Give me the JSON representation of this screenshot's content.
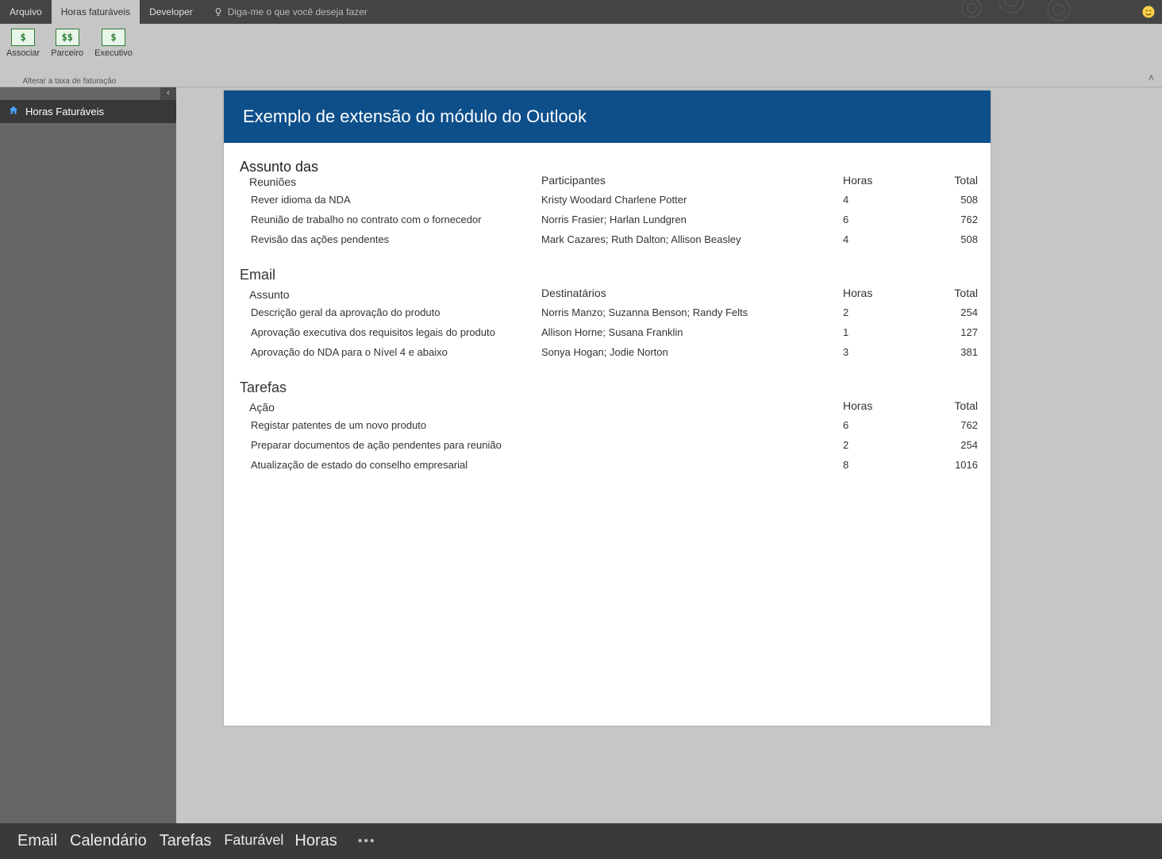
{
  "titlebar": {
    "tabs": [
      {
        "label": "Arquivo"
      },
      {
        "label": "Horas faturáveis"
      },
      {
        "label": "Developer"
      }
    ],
    "tell_me": "Diga-me o que você deseja fazer"
  },
  "ribbon": {
    "buttons": [
      {
        "glyph": "$",
        "label": "Associar"
      },
      {
        "glyph": "$$",
        "label": "Parceiro"
      },
      {
        "glyph": "$",
        "label": "Executivo"
      }
    ],
    "group_label": "Alterar a taxa de faturação"
  },
  "sidebar": {
    "items": [
      {
        "label": "Horas Faturáveis"
      }
    ]
  },
  "page": {
    "title": "Exemplo de extensão do módulo do Outlook",
    "group1_super": "Assunto das",
    "sections": [
      {
        "title": "Reuniões",
        "col2_header": "Participantes",
        "hours_header": "Horas",
        "total_header": "Total",
        "rows": [
          {
            "c1": "Rever idioma da NDA",
            "c2": "Kristy Woodard Charlene Potter",
            "hours": "4",
            "total": "508"
          },
          {
            "c1": "Reunião de trabalho no contrato com o fornecedor",
            "c2": "Norris Frasier; Harlan Lundgren",
            "hours": "6",
            "total": "762"
          },
          {
            "c1": "Revisão das ações pendentes",
            "c2": "Mark Cazares; Ruth Dalton; Allison Beasley",
            "hours": "4",
            "total": "508"
          }
        ]
      },
      {
        "title": "Email",
        "col1_header": "Assunto",
        "col2_header": "Destinatários",
        "hours_header": "Horas",
        "total_header": "Total",
        "rows": [
          {
            "c1": "Descrição geral da aprovação do produto",
            "c2": "Norris Manzo; Suzanna Benson; Randy Felts",
            "hours": "2",
            "total": "254"
          },
          {
            "c1": "Aprovação executiva dos requisitos legais do produto",
            "c2": "Allison Horne; Susana Franklin",
            "hours": "1",
            "total": "127"
          },
          {
            "c1": "Aprovação do NDA para o Nível 4 e abaixo",
            "c2": "Sonya Hogan; Jodie Norton",
            "hours": "3",
            "total": "381"
          }
        ]
      },
      {
        "title": "Tarefas",
        "col1_header": "Ação",
        "hours_header": "Horas",
        "total_header": "Total",
        "rows": [
          {
            "c1": "Registar patentes de um novo produto",
            "c2": "",
            "hours": "6",
            "total": "762"
          },
          {
            "c1": "Preparar documentos de ação pendentes para reunião",
            "c2": "",
            "hours": "2",
            "total": "254"
          },
          {
            "c1": "Atualização de estado do conselho empresarial",
            "c2": "",
            "hours": "8",
            "total": "1016"
          }
        ]
      }
    ]
  },
  "bottombar": {
    "items": [
      "Email",
      "Calendário",
      "Tarefas"
    ],
    "pair": [
      "Faturável",
      "Horas"
    ]
  }
}
